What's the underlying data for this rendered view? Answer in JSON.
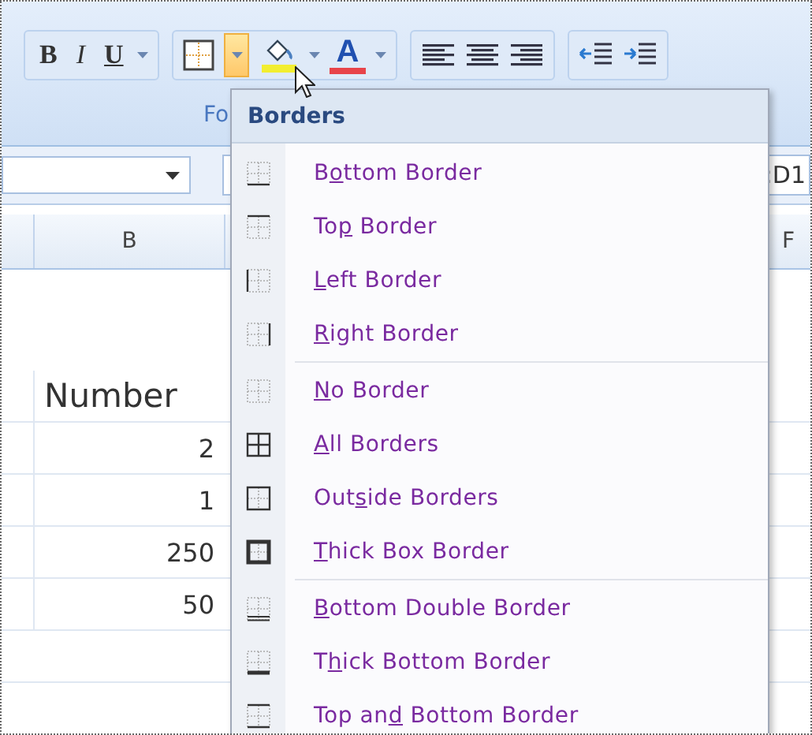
{
  "ribbon": {
    "bold_label": "B",
    "italic_label": "I",
    "underline_label": "U",
    "font_color_label": "A",
    "border_dropdown_hot": true,
    "group_label": "Fo"
  },
  "formula_bar": {
    "cell_ref_tail": ":D1"
  },
  "columns": [
    {
      "label": "B"
    },
    {
      "label": "F"
    }
  ],
  "cells": [
    {
      "text": "Number",
      "kind": "header"
    },
    {
      "text": "2",
      "kind": "number"
    },
    {
      "text": "1",
      "kind": "number"
    },
    {
      "text": "250",
      "kind": "number"
    },
    {
      "text": "50",
      "kind": "number"
    }
  ],
  "menu": {
    "title": "Borders",
    "groups": [
      [
        {
          "label_lead": "B",
          "access_key": "o",
          "label_rest": "ttom Border",
          "kind": "bottom"
        },
        {
          "label_lead": "To",
          "access_key": "p",
          "label_rest": " Border",
          "kind": "top"
        },
        {
          "access_key": "L",
          "label_rest": "eft Border",
          "kind": "left"
        },
        {
          "access_key": "R",
          "label_rest": "ight Border",
          "kind": "right"
        }
      ],
      [
        {
          "access_key": "N",
          "label_rest": "o Border",
          "kind": "none"
        },
        {
          "access_key": "A",
          "label_rest": "ll Borders",
          "kind": "all"
        },
        {
          "label_lead": "Out",
          "access_key": "s",
          "label_rest": "ide Borders",
          "kind": "outside"
        },
        {
          "access_key": "T",
          "label_rest": "hick Box Border",
          "kind": "thick-box"
        }
      ],
      [
        {
          "access_key": "B",
          "label_rest": "ottom Double Border",
          "kind": "bottom-double"
        },
        {
          "label_lead": "T",
          "access_key": "h",
          "label_rest": "ick Bottom Border",
          "kind": "thick-bottom"
        },
        {
          "label_lead": "Top an",
          "access_key": "d",
          "label_rest": " Bottom Border",
          "kind": "top-bottom"
        }
      ]
    ]
  }
}
